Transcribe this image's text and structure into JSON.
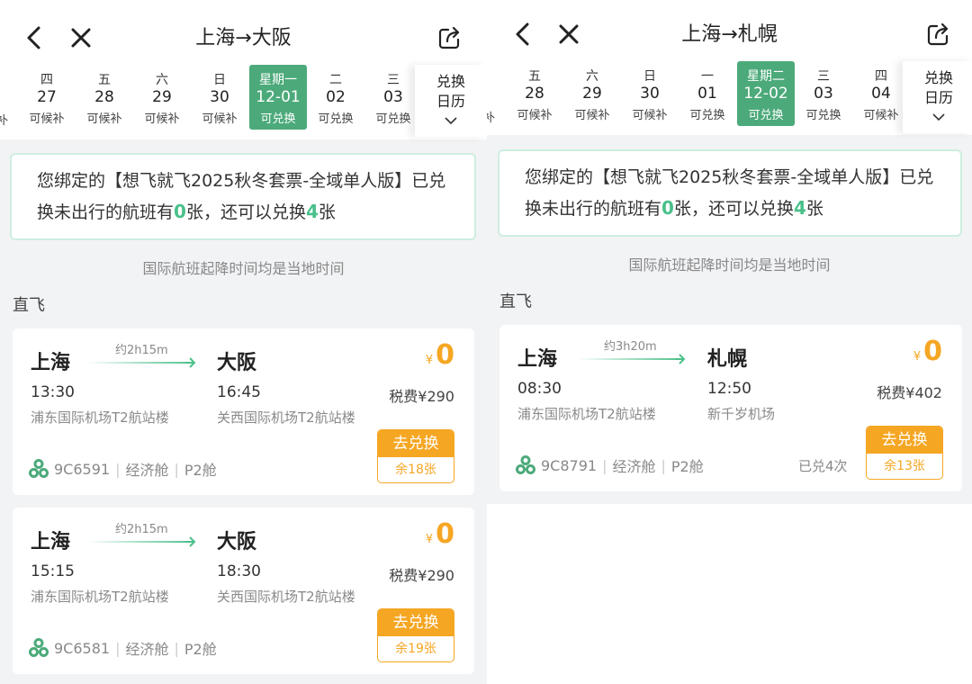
{
  "left": {
    "header": {
      "from": "上海",
      "arrow": "→",
      "to": "大阪"
    },
    "dates": [
      {
        "wd": "四",
        "day": "27",
        "status": "可候补",
        "selected": false
      },
      {
        "wd": "五",
        "day": "28",
        "status": "可候补",
        "selected": false
      },
      {
        "wd": "六",
        "day": "29",
        "status": "可候补",
        "selected": false
      },
      {
        "wd": "日",
        "day": "30",
        "status": "可候补",
        "selected": false
      },
      {
        "wd": "星期一",
        "day": "12-01",
        "status": "可兑换",
        "selected": true
      },
      {
        "wd": "二",
        "day": "02",
        "status": "可兑换",
        "selected": false
      },
      {
        "wd": "三",
        "day": "03",
        "status": "可兑换",
        "selected": false
      }
    ],
    "edge_clip": "补",
    "calendar": {
      "line1": "兑换",
      "line2": "日历"
    },
    "notice": {
      "part1": "您绑定的【想飞就飞2025秋冬套票-全域单人版】已兑换未出行的航班有",
      "count1": "0",
      "part2": "张，还可以兑换",
      "count2": "4",
      "part3": "张"
    },
    "tz_note": "国际航班起降时间均是当地时间",
    "section": "直飞",
    "flights": [
      {
        "from_city": "上海",
        "to_city": "大阪",
        "duration": "约2h15m",
        "dep_time": "13:30",
        "arr_time": "16:45",
        "dep_airport": "浦东国际机场T2航站楼",
        "arr_airport": "关西国际机场T2航站楼",
        "currency": "¥",
        "price": "0",
        "tax": "税费¥290",
        "flight_no": "9C6591",
        "cabin": "经济舱",
        "sub_cabin": "P2舱",
        "sep": "|",
        "redeem": "去兑换",
        "remaining": "余18张"
      },
      {
        "from_city": "上海",
        "to_city": "大阪",
        "duration": "约2h15m",
        "dep_time": "15:15",
        "arr_time": "18:30",
        "dep_airport": "浦东国际机场T2航站楼",
        "arr_airport": "关西国际机场T2航站楼",
        "currency": "¥",
        "price": "0",
        "tax": "税费¥290",
        "flight_no": "9C6581",
        "cabin": "经济舱",
        "sub_cabin": "P2舱",
        "sep": "|",
        "redeem": "去兑换",
        "remaining": "余19张"
      }
    ]
  },
  "right": {
    "header": {
      "from": "上海",
      "arrow": "→",
      "to": "札幌"
    },
    "dates": [
      {
        "wd": "五",
        "day": "28",
        "status": "可候补",
        "selected": false
      },
      {
        "wd": "六",
        "day": "29",
        "status": "可候补",
        "selected": false
      },
      {
        "wd": "日",
        "day": "30",
        "status": "可候补",
        "selected": false
      },
      {
        "wd": "一",
        "day": "01",
        "status": "可兑换",
        "selected": false
      },
      {
        "wd": "星期二",
        "day": "12-02",
        "status": "可兑换",
        "selected": true
      },
      {
        "wd": "三",
        "day": "03",
        "status": "可兑换",
        "selected": false
      },
      {
        "wd": "四",
        "day": "04",
        "status": "可候补",
        "selected": false
      }
    ],
    "edge_clip": "补",
    "calendar": {
      "line1": "兑换",
      "line2": "日历"
    },
    "notice": {
      "part1": "您绑定的【想飞就飞2025秋冬套票-全域单人版】已兑换未出行的航班有",
      "count1": "0",
      "part2": "张，还可以兑换",
      "count2": "4",
      "part3": "张"
    },
    "tz_note": "国际航班起降时间均是当地时间",
    "section": "直飞",
    "flights": [
      {
        "from_city": "上海",
        "to_city": "札幌",
        "duration": "约3h20m",
        "dep_time": "08:30",
        "arr_time": "12:50",
        "dep_airport": "浦东国际机场T2航站楼",
        "arr_airport": "新千岁机场",
        "currency": "¥",
        "price": "0",
        "tax": "税费¥402",
        "flight_no": "9C8791",
        "cabin": "经济舱",
        "sub_cabin": "P2舱",
        "sep": "|",
        "used": "已兑4次",
        "redeem": "去兑换",
        "remaining": "余13张"
      }
    ]
  },
  "colors": {
    "accent_green": "#4caa7a",
    "highlight_green": "#4ac08a",
    "orange": "#f5a623",
    "background": "#f2f3f5"
  },
  "icons": {
    "back": "chevron-left-icon",
    "close": "close-icon",
    "share": "share-icon",
    "airline": "airline-logo-icon",
    "expand": "chevron-down-icon",
    "plane": "plane-arrow-icon"
  }
}
